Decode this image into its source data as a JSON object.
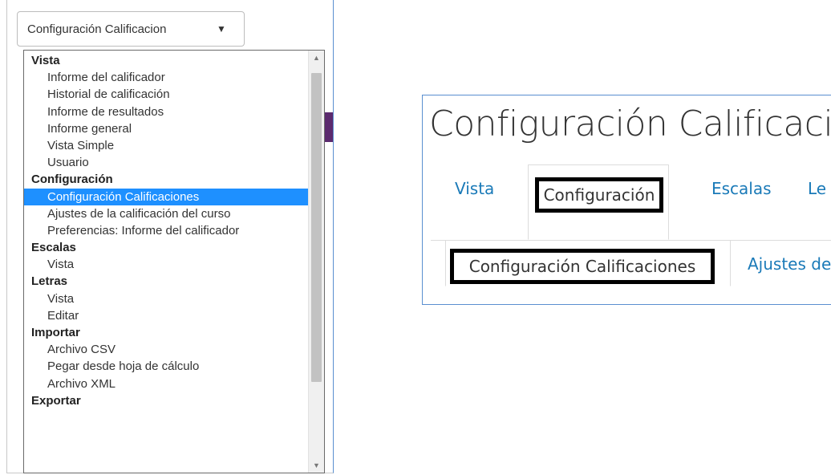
{
  "select": {
    "value": "Configuración Calificacion",
    "arrow": "▼"
  },
  "menu_groups": [
    {
      "label": "Vista",
      "items": [
        "Informe del calificador",
        "Historial de calificación",
        "Informe de resultados",
        "Informe general",
        "Vista Simple",
        "Usuario"
      ]
    },
    {
      "label": "Configuración",
      "items": [
        "Configuración Calificaciones",
        "Ajustes de la calificación del curso",
        "Preferencias: Informe del calificador"
      ]
    },
    {
      "label": "Escalas",
      "items": [
        "Vista"
      ]
    },
    {
      "label": "Letras",
      "items": [
        "Vista",
        "Editar"
      ]
    },
    {
      "label": "Importar",
      "items": [
        "Archivo CSV",
        "Pegar desde hoja de cálculo",
        "Archivo XML"
      ]
    },
    {
      "label": "Exportar",
      "items": []
    }
  ],
  "selected_item": "Configuración Calificaciones",
  "right": {
    "title": "Configuración Calificacio",
    "tabs": [
      "Vista",
      "Configuración",
      "Escalas",
      "Le"
    ],
    "subtabs": [
      "Configuración Calificaciones",
      "Ajustes de"
    ]
  },
  "colors": {
    "selected_bg": "#1e90ff",
    "link": "#1a7ab8",
    "highlight_border": "#000000"
  }
}
